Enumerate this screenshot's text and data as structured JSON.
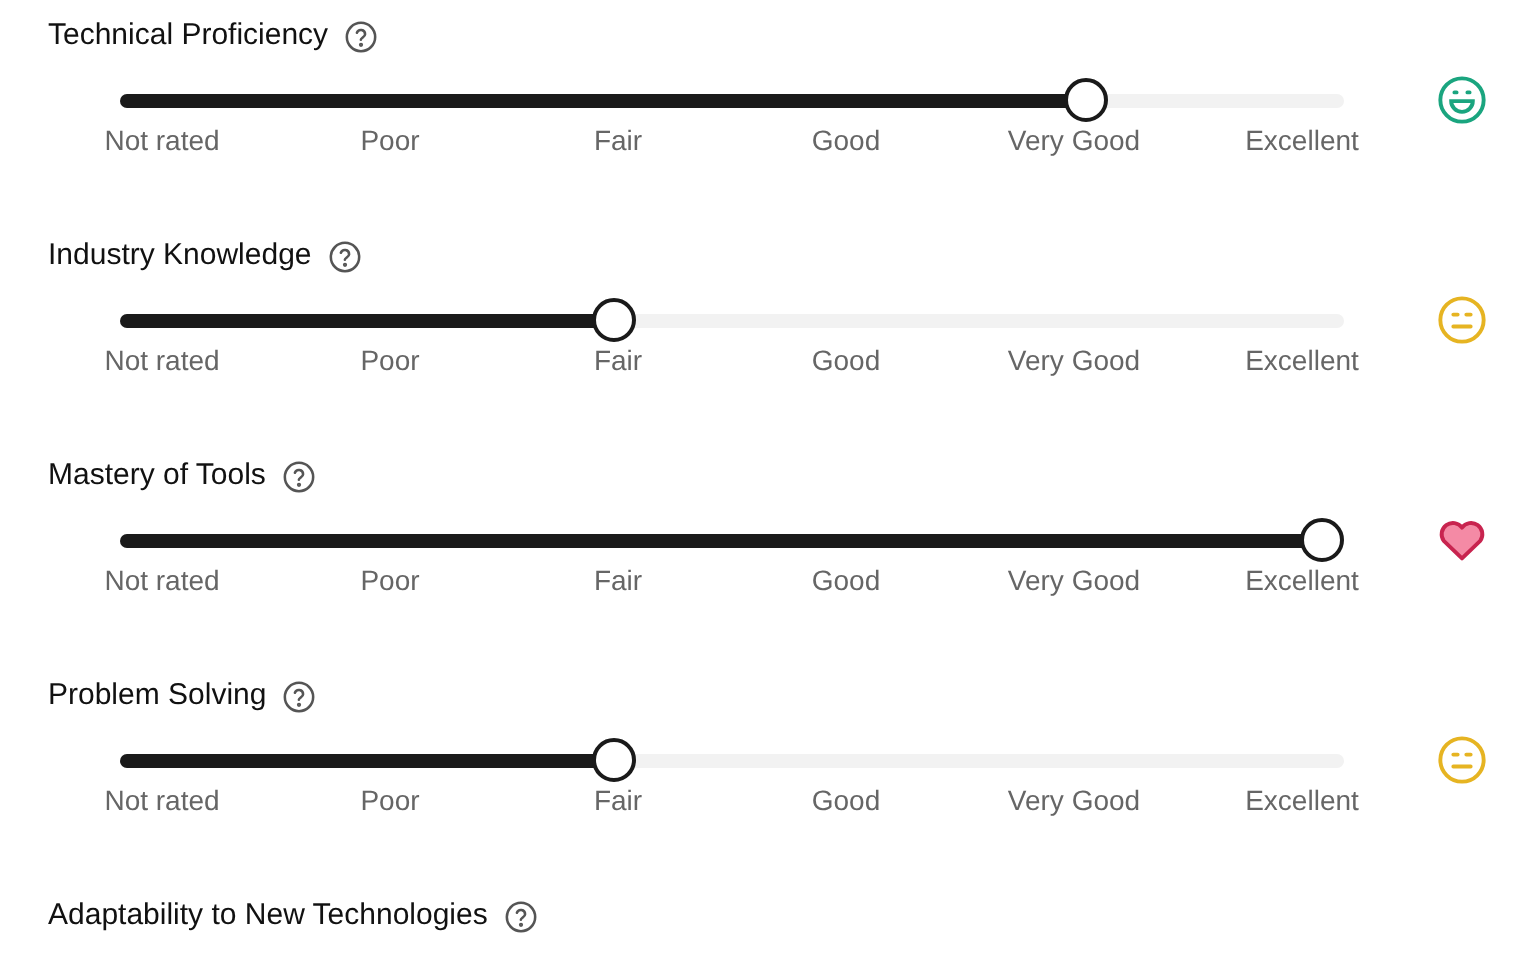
{
  "ratings": [
    {
      "title": "Technical Proficiency",
      "level": 0.8,
      "kind": "happy",
      "scale": [
        "Not rated",
        "Poor",
        "Fair",
        "Good",
        "Very Good",
        "Excellent"
      ]
    },
    {
      "title": "Industry Knowledge",
      "level": 0.4,
      "kind": "neutral",
      "scale": [
        "Not rated",
        "Poor",
        "Fair",
        "Good",
        "Very Good",
        "Excellent"
      ]
    },
    {
      "title": "Mastery of Tools",
      "level": 1,
      "kind": "love",
      "scale": [
        "Not rated",
        "Poor",
        "Fair",
        "Good",
        "Very Good",
        "Excellent"
      ]
    },
    {
      "title": "Problem Solving",
      "level": 0.4,
      "kind": "neutral",
      "scale": [
        "Not rated",
        "Poor",
        "Fair",
        "Good",
        "Very Good",
        "Excellent"
      ]
    },
    {
      "title": "Adaptability to New Technologies"
    }
  ]
}
